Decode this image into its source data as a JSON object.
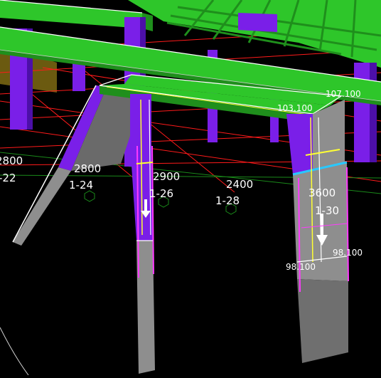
{
  "scene": {
    "background": "#000000",
    "colors": {
      "beam_green": "#2ec62a",
      "beam_green_dark": "#1f8f1c",
      "column_purple": "#7a1fe8",
      "column_purple_dark": "#4c0fa8",
      "grid_red": "#ff1a1a",
      "grid_green": "#1a8a1a",
      "concrete_grey": "#8e8e8e",
      "selection_yellow": "#ffff33",
      "selection_magenta": "#ff3aff",
      "plate_cyan": "#29c8ff"
    }
  },
  "dimensions": [
    {
      "value": "2800"
    },
    {
      "value": "2800"
    },
    {
      "value": "2900"
    },
    {
      "value": "2400"
    },
    {
      "value": "3600"
    }
  ],
  "grid_labels": [
    {
      "text": "-22"
    },
    {
      "text": "1-24"
    },
    {
      "text": "1-26"
    },
    {
      "text": "1-28"
    },
    {
      "text": "1-30"
    }
  ],
  "elevations": [
    {
      "text": "107.100"
    },
    {
      "text": "103.100"
    },
    {
      "text": "98.100"
    },
    {
      "text": "98.100"
    }
  ]
}
